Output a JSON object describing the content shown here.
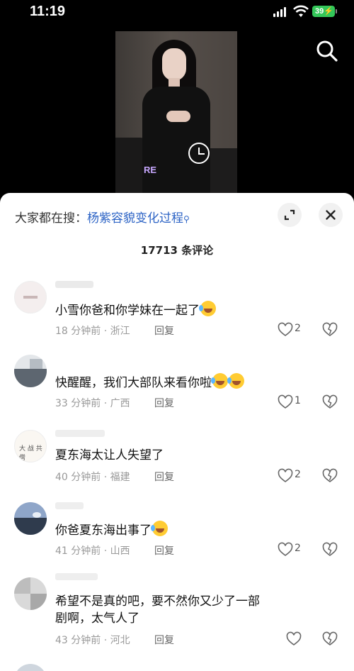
{
  "status_bar": {
    "time": "11:19",
    "battery": "39"
  },
  "video": {
    "overlay_text": "RE"
  },
  "sheet": {
    "search_prefix": "大家都在搜：",
    "search_term": "杨紫容貌变化过程",
    "comment_count": "17713 条评论",
    "reply_label": "回复"
  },
  "comments": [
    {
      "text": "小雪你爸和你学妹在一起了",
      "emoji_count": 1,
      "meta": "18 分钟前 · 浙江",
      "likes": "2"
    },
    {
      "text": "快醒醒，我们大部队来看你啦",
      "emoji_count": 2,
      "meta": "33 分钟前 · 广西",
      "likes": "1"
    },
    {
      "text": "夏东海太让人失望了",
      "emoji_count": 0,
      "meta": "40 分钟前 · 福建",
      "likes": "2"
    },
    {
      "text": "你爸夏东海出事了",
      "emoji_count": 1,
      "meta": "41 分钟前 · 山西",
      "likes": "2"
    },
    {
      "text": "希望不是真的吧，要不然你又少了一部剧啊，太气人了",
      "emoji_count": 0,
      "meta": "43 分钟前 · 河北",
      "likes": ""
    }
  ],
  "colors": {
    "accent_link": "#2c63c5",
    "battery": "#34c759"
  },
  "icons": {
    "search": "search-icon",
    "expand": "expand-icon",
    "close": "close-icon",
    "like": "heart-icon",
    "dislike": "broken-heart-icon"
  }
}
